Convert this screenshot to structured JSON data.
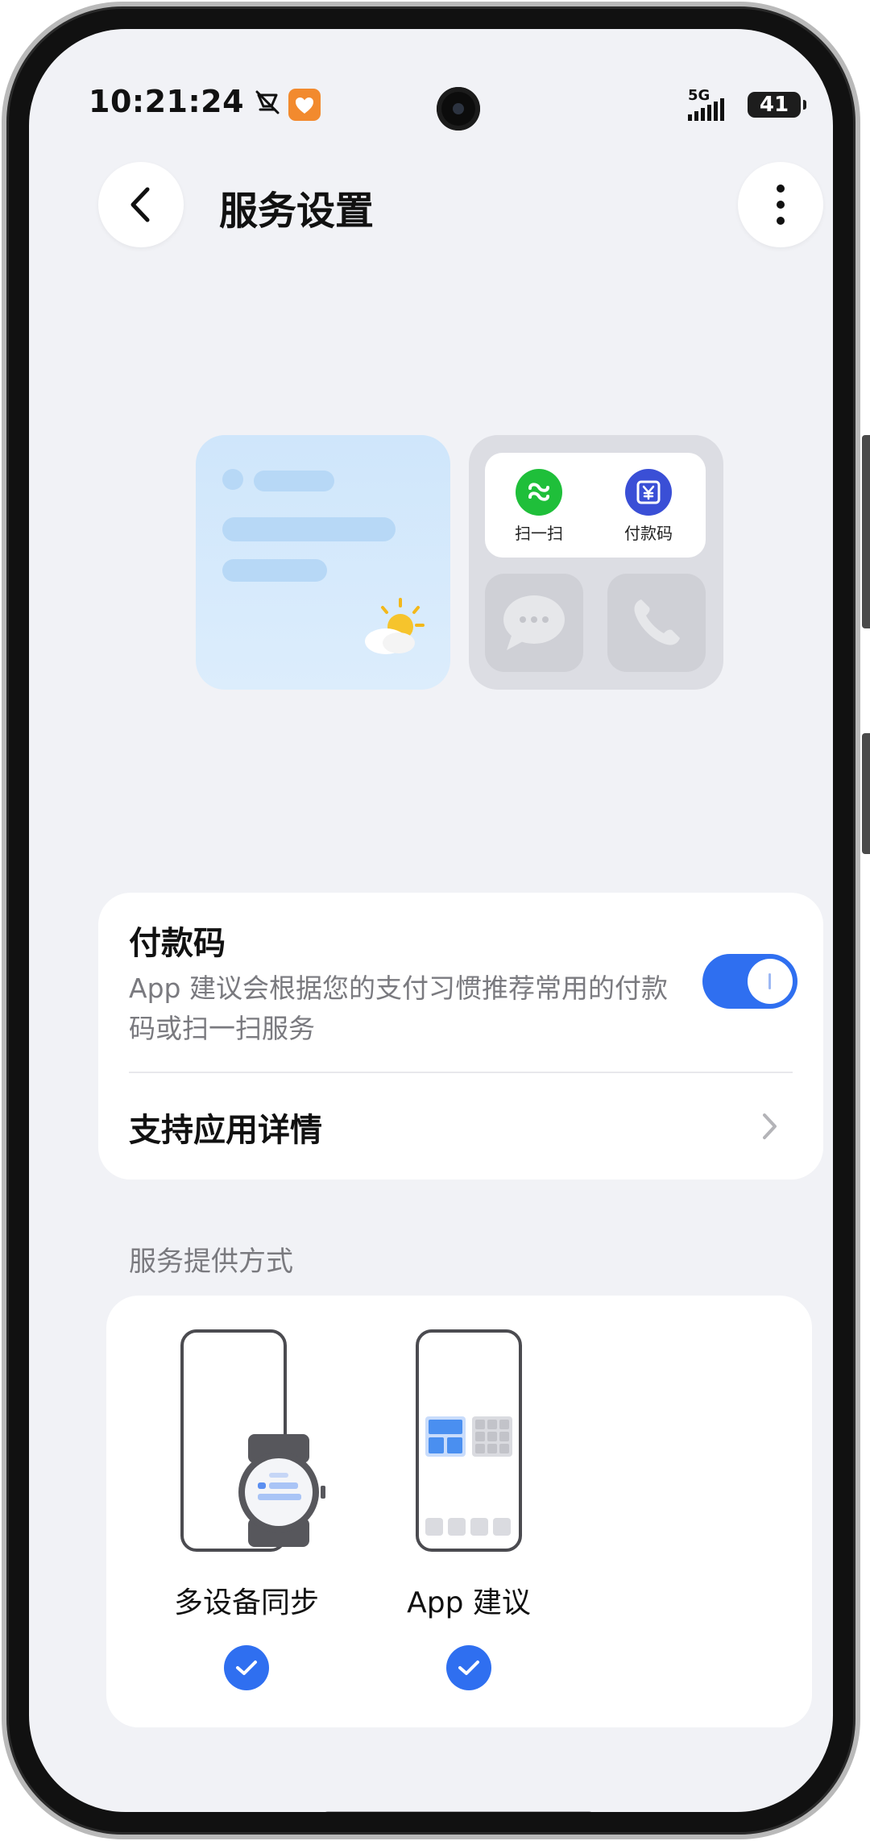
{
  "status_bar": {
    "time": "10:21:24",
    "network": "5G",
    "battery": "41"
  },
  "header": {
    "title": "服务设置"
  },
  "illustration": {
    "shortcut_scan_label": "扫一扫",
    "shortcut_pay_label": "付款码"
  },
  "payment_card": {
    "title": "付款码",
    "description": "App 建议会根据您的支付习惯推荐常用的付款码或扫一扫服务",
    "toggle_on": true,
    "support_label": "支持应用详情"
  },
  "service_section": {
    "title": "服务提供方式",
    "modes": [
      {
        "label": "多设备同步",
        "checked": true
      },
      {
        "label": "App 建议",
        "checked": true
      }
    ]
  },
  "colors": {
    "accent": "#2f6ff0",
    "background": "#f1f2f6",
    "secondary_text": "#7a7a7f"
  },
  "icons": [
    "back-arrow-icon",
    "more-vertical-icon",
    "chevron-right-icon",
    "check-icon",
    "message-icon",
    "phone-icon",
    "sun-cloud-icon"
  ]
}
